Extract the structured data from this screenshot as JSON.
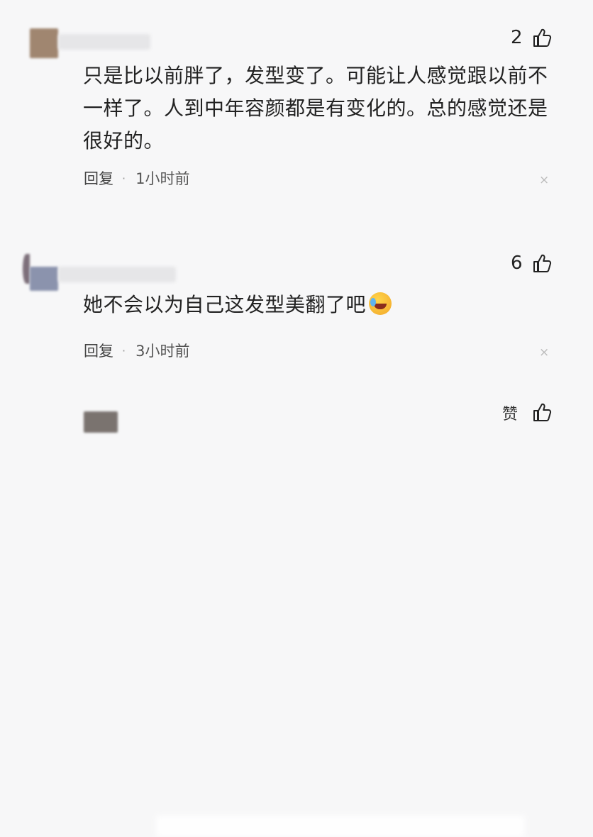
{
  "comments": [
    {
      "likes": "2",
      "text": "只是比以前胖了，发型变了。可能让人感觉跟以前不一样了。人到中年容颜都是有变化的。总的感觉还是很好的。",
      "reply_label": "回复",
      "separator": "·",
      "time": "1小时前",
      "close": "×"
    },
    {
      "likes": "6",
      "text": "她不会以为自己这发型美翻了吧",
      "reply_label": "回复",
      "separator": "·",
      "time": "3小时前",
      "close": "×"
    }
  ],
  "third_comment": {
    "like_label": "赞"
  },
  "icons": {
    "like": "thumbs-up-icon",
    "close": "close-icon",
    "emoji": "laughing-crying-emoji"
  },
  "colors": {
    "background": "#f7f7f8",
    "text": "#222222",
    "meta": "#444444"
  }
}
